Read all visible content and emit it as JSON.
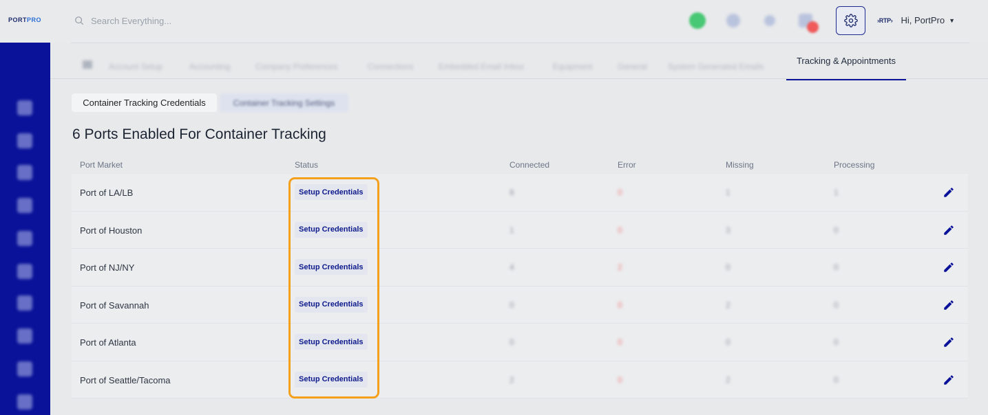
{
  "header": {
    "logo": {
      "part1": "PORT",
      "part2": "PRO"
    },
    "search_placeholder": "Search Everything...",
    "user_logo": "›RTP›",
    "user_greeting": "Hi, PortPro",
    "icons": [
      "search-icon",
      "gear-icon",
      "caret-down-icon"
    ]
  },
  "subnav": {
    "items": [
      "Account Setup",
      "Accounting",
      "Company Preferences",
      "Connections",
      "Embedded Email Inbox",
      "Equipment",
      "General",
      "System Generated Emails"
    ],
    "active": "Tracking & Appointments"
  },
  "tabs": {
    "active": "Container Tracking Credentials",
    "other": "Container Tracking Settings"
  },
  "page": {
    "title": "6 Ports Enabled For Container Tracking"
  },
  "table": {
    "columns": [
      "Port Market",
      "Status",
      "Connected",
      "Error",
      "Missing",
      "Processing"
    ],
    "rows": [
      {
        "port": "Port of LA/LB",
        "status": "Setup Credentials",
        "connected": "8",
        "error": "0",
        "missing": "1",
        "processing": "1"
      },
      {
        "port": "Port of Houston",
        "status": "Setup Credentials",
        "connected": "1",
        "error": "0",
        "missing": "3",
        "processing": "0"
      },
      {
        "port": "Port of NJ/NY",
        "status": "Setup Credentials",
        "connected": "4",
        "error": "2",
        "missing": "0",
        "processing": "0"
      },
      {
        "port": "Port of Savannah",
        "status": "Setup Credentials",
        "connected": "0",
        "error": "0",
        "missing": "2",
        "processing": "0"
      },
      {
        "port": "Port of Atlanta",
        "status": "Setup Credentials",
        "connected": "0",
        "error": "0",
        "missing": "0",
        "processing": "0"
      },
      {
        "port": "Port of Seattle/Tacoma",
        "status": "Setup Credentials",
        "connected": "2",
        "error": "0",
        "missing": "2",
        "processing": "0"
      }
    ]
  },
  "colors": {
    "sidebar": "#0a1299",
    "accent": "#0a1299",
    "highlight": "#f5a01a",
    "status_text": "#0d1a8c"
  }
}
